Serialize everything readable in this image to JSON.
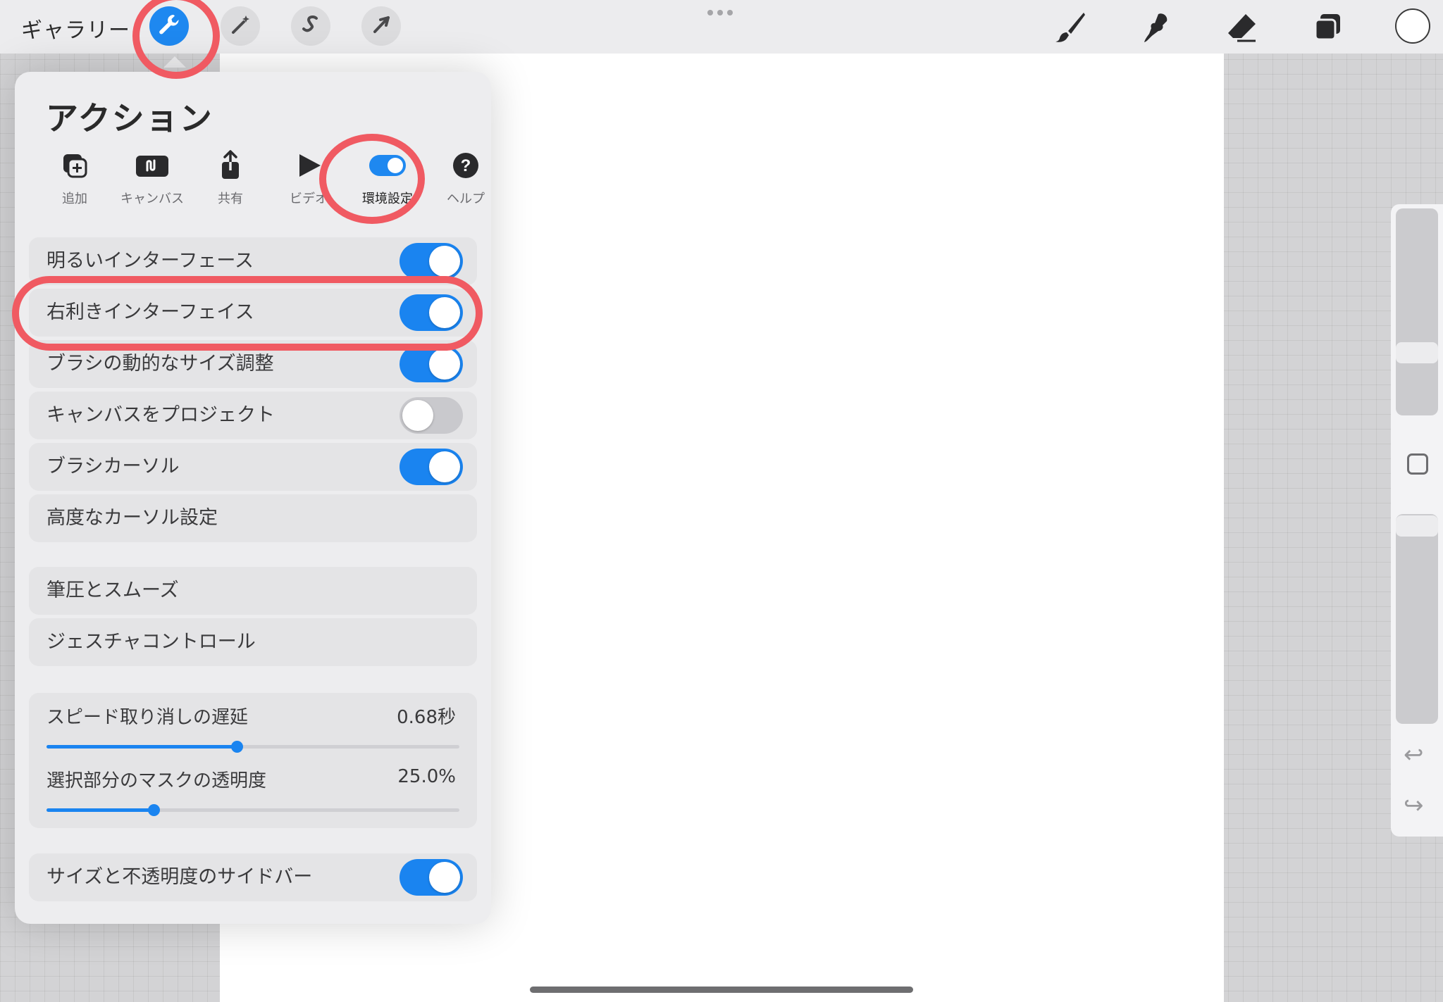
{
  "topbar": {
    "gallery_label": "ギャラリー",
    "left_tools": [
      "wrench-icon",
      "magic-wand-icon",
      "s-curve-icon",
      "arrow-icon"
    ],
    "right_tools": [
      "brush-icon",
      "smudge-icon",
      "eraser-icon",
      "layers-icon"
    ],
    "active_tool": "wrench-icon",
    "accent": "#1e88f0"
  },
  "panel": {
    "title": "アクション",
    "tabs": [
      {
        "label": "追加",
        "icon": "add-icon"
      },
      {
        "label": "キャンバス",
        "icon": "canvas-icon"
      },
      {
        "label": "共有",
        "icon": "share-icon"
      },
      {
        "label": "ビデオ",
        "icon": "play-icon"
      },
      {
        "label": "環境設定",
        "icon": "toggle-icon"
      },
      {
        "label": "ヘルプ",
        "icon": "help-icon"
      }
    ],
    "selected_tab": "環境設定",
    "settings": [
      {
        "label": "明るいインターフェース",
        "on": true
      },
      {
        "label": "右利きインターフェイス",
        "on": true
      },
      {
        "label": "ブラシの動的なサイズ調整",
        "on": true
      },
      {
        "label": "キャンバスをプロジェクト",
        "on": false
      },
      {
        "label": "ブラシカーソル",
        "on": true
      },
      {
        "label": "高度なカーソル設定"
      }
    ],
    "links": [
      "筆圧とスムーズ",
      "ジェスチャコントロール"
    ],
    "sliders": [
      {
        "label": "スピード取り消しの遅延",
        "value": "0.68秒",
        "fraction": 0.46
      },
      {
        "label": "選択部分のマスクの透明度",
        "value": "25.0%",
        "fraction": 0.26
      }
    ],
    "sidebar_setting": {
      "label": "サイズと不透明度のサイドバー",
      "on": true
    }
  },
  "colors": {
    "highlight": "#f05a62",
    "toggle_on": "#1a84f0",
    "toggle_off": "#c9c9cd"
  }
}
